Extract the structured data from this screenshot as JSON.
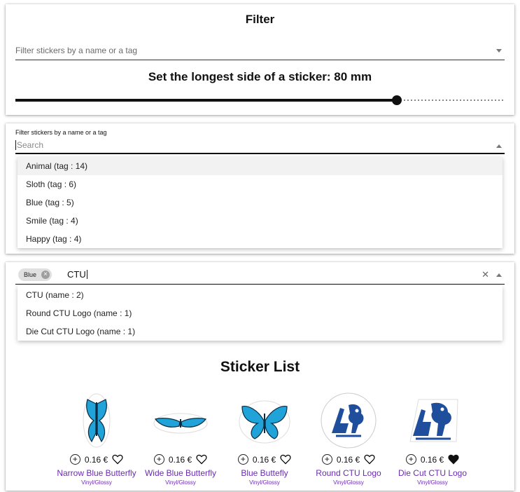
{
  "panel1": {
    "title": "Filter",
    "filter_placeholder": "Filter stickers by a name or a tag",
    "size_label": "Set the longest side of a sticker: 80 mm",
    "slider_value_fraction": 0.78
  },
  "panel2": {
    "field_label": "Filter stickers by a name or a tag",
    "search_placeholder": "Search",
    "options": [
      "Animal (tag : 14)",
      "Sloth (tag : 6)",
      "Blue (tag : 5)",
      "Smile (tag : 4)",
      "Happy (tag : 4)"
    ]
  },
  "panel3": {
    "chip_label": "Blue",
    "typed_text": "CTU",
    "clear_symbol": "✕",
    "options": [
      "CTU (name : 2)",
      "Round CTU Logo (name : 1)",
      "Die Cut CTU Logo (name : 1)"
    ],
    "heading": "Sticker List"
  },
  "stickers": [
    {
      "name": "Narrow Blue Butterfly",
      "price": "0.16 €",
      "material": "Vinyl/Glossy",
      "favorite": false,
      "icon": "narrow-butterfly"
    },
    {
      "name": "Wide Blue Butterfly",
      "price": "0.16 €",
      "material": "Vinyl/Glossy",
      "favorite": false,
      "icon": "wide-butterfly"
    },
    {
      "name": "Blue Buttefly",
      "price": "0.16 €",
      "material": "Vinyl/Glossy",
      "favorite": false,
      "icon": "butterfly"
    },
    {
      "name": "Round CTU Logo",
      "price": "0.16 €",
      "material": "Vinyl/Glossy",
      "favorite": false,
      "icon": "round-ctu-logo"
    },
    {
      "name": "Die Cut CTU Logo",
      "price": "0.16 €",
      "material": "Vinyl/Glossy",
      "favorite": true,
      "icon": "ctu-logo"
    }
  ],
  "colors": {
    "accent": "#6a2bb3",
    "sticker_blue": "#1fa3d8",
    "logo_blue": "#1f4f9c"
  }
}
